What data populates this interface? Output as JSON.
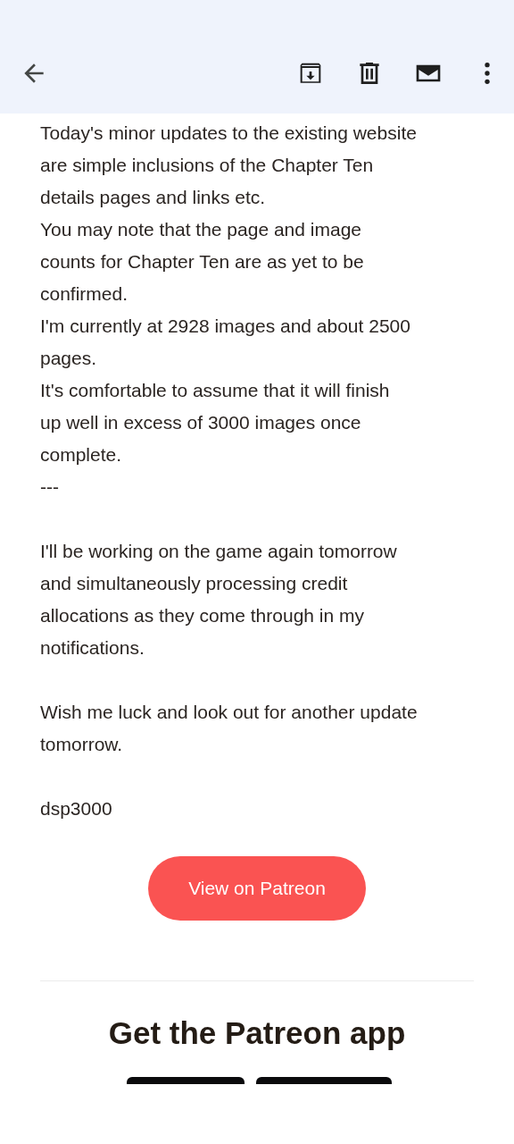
{
  "toolbar": {
    "actions": [
      {
        "kind": "back"
      },
      {
        "kind": "archive"
      },
      {
        "kind": "delete"
      },
      {
        "kind": "mail"
      },
      {
        "kind": "more"
      }
    ]
  },
  "paragraphs": [
    {
      "lines": [
        "Today's minor updates to the existing website",
        "are simple inclusions of the Chapter Ten",
        "details pages and links etc.",
        "You may note that the page and image",
        "counts for Chapter Ten are as yet to be",
        "confirmed.",
        "I'm currently at 2928 images and about 2500",
        "pages.",
        "It's comfortable to assume that it will finish",
        "up well in excess of 3000 images once",
        "complete.",
        "---"
      ]
    },
    {
      "lines": [
        "I'll be working on the game again tomorrow",
        "and simultaneously processing credit",
        "allocations as they come through in my",
        "notifications."
      ]
    },
    {
      "lines": [
        "Wish me luck and look out for another update",
        "tomorrow."
      ]
    },
    {
      "lines": [
        "dsp3000"
      ]
    }
  ],
  "button": {
    "label": "View on Patreon"
  },
  "app_promo": {
    "heading": "Get the Patreon app"
  }
}
